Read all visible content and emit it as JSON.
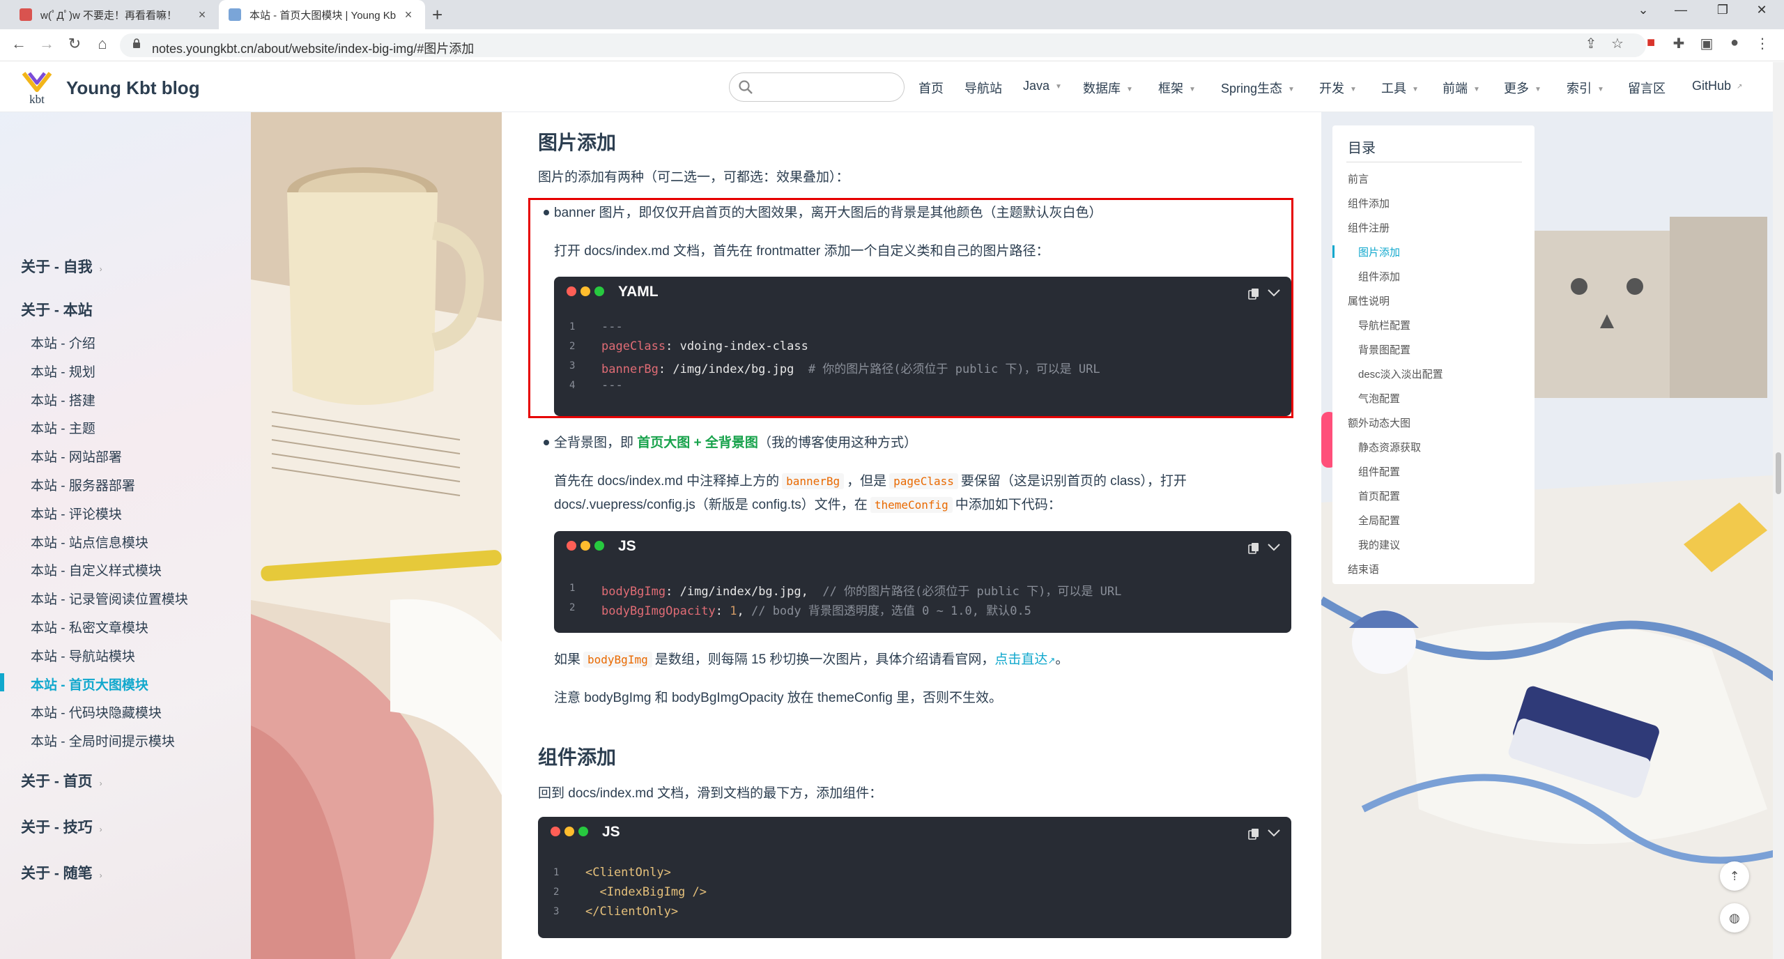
{
  "browser": {
    "tabs": [
      {
        "title": "w(ﾟДﾟ)w 不要走！再看看嘛！",
        "active": false
      },
      {
        "title": "本站 - 首页大图模块 | Young Kbt blog",
        "active": true
      }
    ],
    "url": "notes.youngkbt.cn/about/website/index-big-img/#图片添加",
    "window_controls": [
      "chevron-down",
      "minimize",
      "restore",
      "close"
    ]
  },
  "site": {
    "name": "Young Kbt blog",
    "logo_text": "kbt",
    "search_placeholder": "",
    "nav": [
      {
        "label": "首页",
        "dropdown": false
      },
      {
        "label": "导航站",
        "dropdown": false
      },
      {
        "label": "Java",
        "dropdown": true
      },
      {
        "label": "数据库",
        "dropdown": true
      },
      {
        "label": "框架",
        "dropdown": true
      },
      {
        "label": "Spring生态",
        "dropdown": true
      },
      {
        "label": "开发",
        "dropdown": true
      },
      {
        "label": "工具",
        "dropdown": true
      },
      {
        "label": "前端",
        "dropdown": true
      },
      {
        "label": "更多",
        "dropdown": true
      },
      {
        "label": "索引",
        "dropdown": true
      },
      {
        "label": "留言区",
        "dropdown": false
      },
      {
        "label": "GitHub",
        "dropdown": false
      }
    ]
  },
  "sidebar": {
    "groups": [
      {
        "label": "关于 - 自我"
      },
      {
        "label": "关于 - 本站"
      },
      {
        "label": "关于 - 首页"
      },
      {
        "label": "关于 - 技巧"
      },
      {
        "label": "关于 - 随笔"
      }
    ],
    "items": [
      "本站 - 介绍",
      "本站 - 规划",
      "本站 - 搭建",
      "本站 - 主题",
      "本站 - 网站部署",
      "本站 - 服务器部署",
      "本站 - 评论模块",
      "本站 - 站点信息模块",
      "本站 - 自定义样式模块",
      "本站 - 记录管阅读位置模块",
      "本站 - 私密文章模块",
      "本站 - 导航站模块",
      "本站 - 首页大图模块",
      "本站 - 代码块隐藏模块",
      "本站 - 全局时间提示模块"
    ],
    "active_item": "本站 - 首页大图模块"
  },
  "content": {
    "h_image_add": "图片添加",
    "intro": "图片的添加有两种（可二选一，可都选：效果叠加）：",
    "b1_text": "banner 图片，即仅仅开启首页的大图效果，离开大图后的背景是其他颜色（主题默认灰白色）",
    "b1_p": "打开 docs/index.md 文档，首先在 frontmatter 添加一个自定义类和自己的图片路径：",
    "code1": {
      "lang": "YAML",
      "lines": [
        {
          "n": "1",
          "parts": [
            {
              "t": "---",
              "c": "c"
            }
          ]
        },
        {
          "n": "2",
          "parts": [
            {
              "t": "pageClass",
              "c": "k"
            },
            {
              "t": ": vdoing-index-class",
              "c": ""
            }
          ]
        },
        {
          "n": "3",
          "parts": [
            {
              "t": "bannerBg",
              "c": "k"
            },
            {
              "t": ": /img/index/bg.jpg  ",
              "c": ""
            },
            {
              "t": "# 你的图片路径(必须位于 public 下)，可以是 URL",
              "c": "c"
            }
          ]
        },
        {
          "n": "4",
          "parts": [
            {
              "t": "---",
              "c": "c"
            }
          ]
        }
      ]
    },
    "b2_pre": "全背景图，即 ",
    "b2_green": "首页大图 + 全背景图",
    "b2_post": "（我的博客使用这种方式）",
    "b2_p1_a": "首先在 docs/index.md 中注释掉上方的",
    "b2_p1_code1": "bannerBg",
    "b2_p1_b": "，但是",
    "b2_p1_code2": "pageClass",
    "b2_p1_c": "要保留（这是识别首页的 class），打开",
    "b2_p2_a": "docs/.vuepress/config.js（新版是 config.ts）文件，在",
    "b2_p2_code": "themeConfig",
    "b2_p2_b": "中添加如下代码：",
    "code2": {
      "lang": "JS",
      "lines": [
        {
          "n": "1",
          "parts": [
            {
              "t": "bodyBgImg",
              "c": "k"
            },
            {
              "t": ": ",
              "c": ""
            },
            {
              "t": "/img/index/bg.jpg",
              "c": ""
            },
            {
              "t": ",  ",
              "c": ""
            },
            {
              "t": "// 你的图片路径(必须位于 public 下)，可以是 URL",
              "c": "c"
            }
          ]
        },
        {
          "n": "2",
          "parts": [
            {
              "t": "bodyBgImgOpacity",
              "c": "k"
            },
            {
              "t": ": ",
              "c": ""
            },
            {
              "t": "1",
              "c": "n"
            },
            {
              "t": ", ",
              "c": ""
            },
            {
              "t": "// body 背景图透明度，选值 0 ~ 1.0, 默认0.5",
              "c": "c"
            }
          ]
        }
      ]
    },
    "p3_a": "如果",
    "p3_code": "bodyBgImg",
    "p3_b": "是数组，则每隔 15 秒切换一次图片，具体介绍请看官网，",
    "p3_link": "点击直达",
    "p3_c": "。",
    "p4": "注意 bodyBgImg 和 bodyBgImgOpacity 放在 themeConfig 里，否则不生效。",
    "h_comp_add": "组件添加",
    "p5": "回到 docs/index.md 文档，滑到文档的最下方，添加组件：",
    "code3": {
      "lang": "JS",
      "lines": [
        {
          "n": "1",
          "parts": [
            {
              "t": "<ClientOnly>",
              "c": "t"
            }
          ]
        },
        {
          "n": "2",
          "parts": [
            {
              "t": "  <IndexBigImg />",
              "c": "t"
            }
          ]
        },
        {
          "n": "3",
          "parts": [
            {
              "t": "</ClientOnly>",
              "c": "t"
            }
          ]
        }
      ]
    }
  },
  "toc": {
    "title": "目录",
    "items": [
      {
        "label": "前言",
        "level": 1
      },
      {
        "label": "组件添加",
        "level": 1
      },
      {
        "label": "组件注册",
        "level": 1
      },
      {
        "label": "图片添加",
        "level": 2
      },
      {
        "label": "组件添加",
        "level": 2
      },
      {
        "label": "属性说明",
        "level": 1
      },
      {
        "label": "导航栏配置",
        "level": 2
      },
      {
        "label": "背景图配置",
        "level": 2
      },
      {
        "label": "desc淡入淡出配置",
        "level": 2
      },
      {
        "label": "气泡配置",
        "level": 2
      },
      {
        "label": "额外动态大图",
        "level": 1
      },
      {
        "label": "静态资源获取",
        "level": 2
      },
      {
        "label": "组件配置",
        "level": 2
      },
      {
        "label": "首页配置",
        "level": 2
      },
      {
        "label": "全局配置",
        "level": 2
      },
      {
        "label": "我的建议",
        "level": 2
      },
      {
        "label": "结束语",
        "level": 1
      }
    ],
    "active": "图片添加"
  },
  "colors": {
    "accent": "#11a8cd",
    "highlight_box": "#e60000",
    "code_bg": "#282c34",
    "progress": "#7b4cd8",
    "green_text": "#17a24b"
  }
}
